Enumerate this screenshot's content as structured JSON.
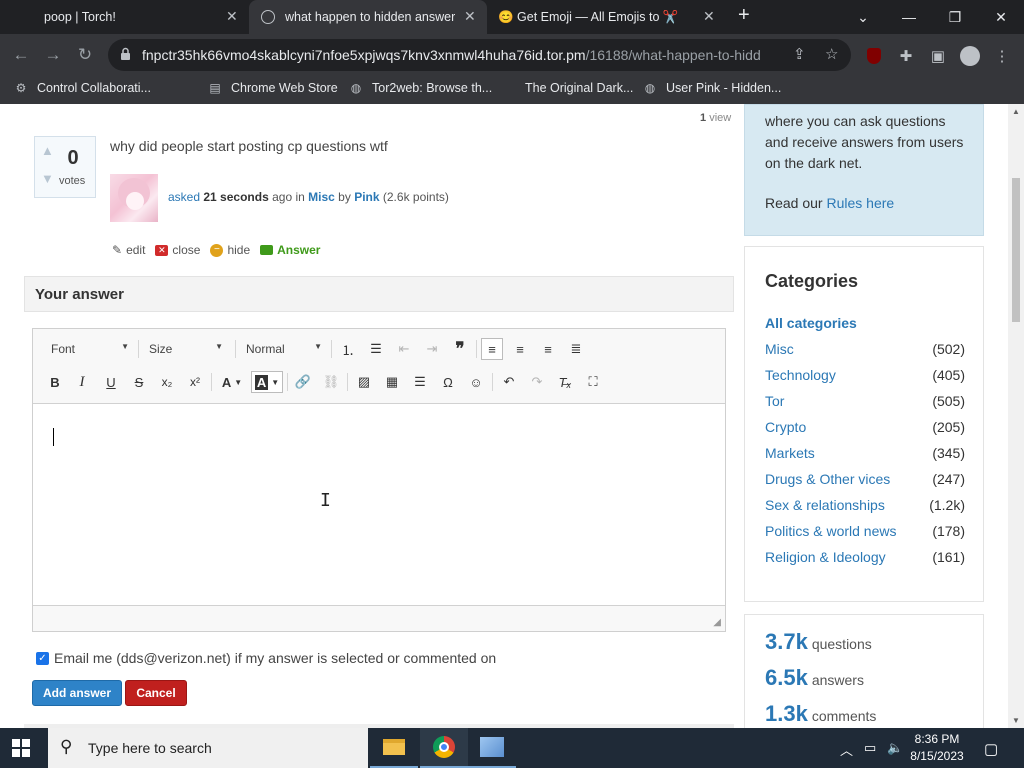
{
  "browser": {
    "tabs": [
      {
        "title": "poop | Torch!",
        "active": false
      },
      {
        "title": "what happen to hidden answers",
        "active": true
      },
      {
        "title": "😊 Get Emoji — All Emojis to ✂️",
        "active": false
      }
    ],
    "url_main": "fnpctr35hk66vmo4skablcyni7nfoe5xpjwqs7knv3xnmwl4huha76id.tor.pm",
    "url_path": "/16188/what-happen-to-hidd...",
    "bookmarks": [
      "Control Collaborati...",
      "Chrome Web Store",
      "Tor2web: Browse th...",
      "The Original Dark...",
      "User Pink - Hidden..."
    ]
  },
  "question": {
    "view_count": "1",
    "view_label": "view",
    "votes": "0",
    "votes_label": "votes",
    "title": "why did people start posting cp questions wtf",
    "asked": "asked",
    "when": "21 seconds",
    "ago": "ago in",
    "category": "Misc",
    "by": "by",
    "author": "Pink",
    "points": "(2.6k points)",
    "actions": {
      "edit": "edit",
      "close": "close",
      "hide": "hide",
      "answer": "Answer"
    }
  },
  "answer_form": {
    "heading": "Your answer",
    "font_label": "Font",
    "size_label": "Size",
    "format_label": "Normal",
    "email_label": "Email me (dds@verizon.net) if my answer is selected or commented on",
    "email_checked": true,
    "submit": "Add answer",
    "cancel": "Cancel"
  },
  "sidebar": {
    "intro": "where you can ask questions and receive answers from users on the dark net.",
    "rules_prefix": "Read our",
    "rules_link": "Rules here",
    "categories_title": "Categories",
    "all_categories": "All categories",
    "categories": [
      {
        "name": "Misc",
        "count": "(502)"
      },
      {
        "name": "Technology",
        "count": "(405)"
      },
      {
        "name": "Tor",
        "count": "(505)"
      },
      {
        "name": "Crypto",
        "count": "(205)"
      },
      {
        "name": "Markets",
        "count": "(345)"
      },
      {
        "name": "Drugs & Other vices",
        "count": "(247)"
      },
      {
        "name": "Sex & relationships",
        "count": "(1.2k)"
      },
      {
        "name": "Politics & world news",
        "count": "(178)"
      },
      {
        "name": "Religion & Ideology",
        "count": "(161)"
      }
    ],
    "stats": [
      {
        "value": "3.7k",
        "label": "questions"
      },
      {
        "value": "6.5k",
        "label": "answers"
      },
      {
        "value": "1.3k",
        "label": "comments"
      }
    ]
  },
  "taskbar": {
    "search_placeholder": "Type here to search",
    "time": "8:36 PM",
    "date": "8/15/2023"
  },
  "colors": {
    "link": "#2b78b5",
    "add_button": "#2e83c8",
    "cancel_button": "#c0201e",
    "intro_panel": "#d7e9f2"
  }
}
